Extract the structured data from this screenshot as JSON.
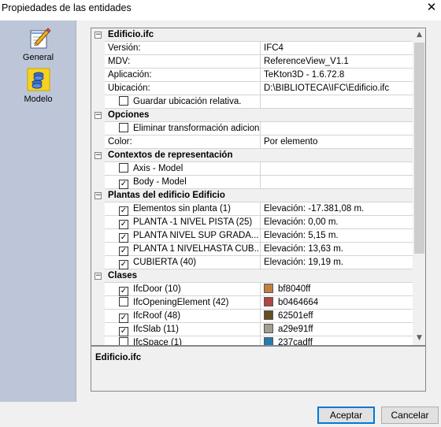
{
  "window": {
    "title": "Propiedades de las entidades",
    "close_glyph": "✕"
  },
  "sidebar": {
    "items": [
      {
        "label": "General",
        "icon": "pencil-notepad-icon"
      },
      {
        "label": "Modelo",
        "icon": "model-stack-icon"
      }
    ]
  },
  "sections": [
    {
      "title": "Edificio.ifc",
      "collapse_glyph": "⊟",
      "rows": [
        {
          "name": "Versión:",
          "value": "IFC4"
        },
        {
          "name": "MDV:",
          "value": "ReferenceView_V1.1"
        },
        {
          "name": "Aplicación:",
          "value": "TeKton3D - 1.6.72.8"
        },
        {
          "name": "Ubicación:",
          "value": "D:\\BIBLIOTECA\\IFC\\Edificio.ifc"
        },
        {
          "name": "Guardar ubicación relativa.",
          "value": "",
          "checked": false
        }
      ]
    },
    {
      "title": "Opciones",
      "rows": [
        {
          "name": "Eliminar transformación adicion...",
          "value": "",
          "checked": false
        },
        {
          "name": "Color:",
          "value": "Por elemento"
        }
      ]
    },
    {
      "title": "Contextos de representación",
      "rows": [
        {
          "name": "Axis - Model",
          "value": "",
          "checked": false
        },
        {
          "name": "Body - Model",
          "value": "",
          "checked": true
        }
      ]
    },
    {
      "title": "Plantas del edificio Edificio",
      "rows": [
        {
          "name": "Elementos sin planta (1)",
          "value": "Elevación: -17.381,08 m.",
          "checked": true
        },
        {
          "name": "PLANTA -1 NIVEL PISTA (25)",
          "value": "Elevación: 0,00 m.",
          "checked": true
        },
        {
          "name": "PLANTA NIVEL SUP GRADA...",
          "value": "Elevación: 5,15 m.",
          "checked": true
        },
        {
          "name": "PLANTA 1 NIVELHASTA CUB...",
          "value": "Elevación: 13,63 m.",
          "checked": true
        },
        {
          "name": "CUBIERTA (40)",
          "value": "Elevación: 19,19 m.",
          "checked": true
        }
      ]
    },
    {
      "title": "Clases",
      "rows": [
        {
          "name": "IfcDoor (10)",
          "value": "bf8040ff",
          "checked": true,
          "color": "#bf8040"
        },
        {
          "name": "IfcOpeningElement (42)",
          "value": "b0464664",
          "checked": false,
          "color": "#b04646"
        },
        {
          "name": "IfcRoof (48)",
          "value": "62501eff",
          "checked": true,
          "color": "#62501e"
        },
        {
          "name": "IfcSlab (11)",
          "value": "a29e91ff",
          "checked": true,
          "color": "#a29e91"
        },
        {
          "name": "IfcSpace (1)",
          "value": "237cadff",
          "checked": false,
          "color": "#237cad"
        }
      ]
    }
  ],
  "description": {
    "title": "Edificio.ifc"
  },
  "buttons": {
    "accept": "Aceptar",
    "cancel": "Cancelar"
  },
  "check_glyph": "✓",
  "colors": {
    "sidebar_bg": "#bcc6d8",
    "accent": "#0078d7"
  }
}
